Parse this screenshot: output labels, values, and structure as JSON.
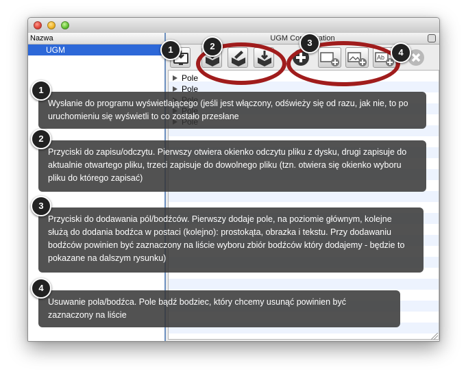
{
  "window": {
    "title": "UGM Configuration",
    "left_header": "Nazwa",
    "left_items": [
      "UGM"
    ]
  },
  "tree_rows": [
    "Pole",
    "Pole",
    "Pole",
    "Pole",
    "Pole"
  ],
  "toolbar": {
    "buttons": [
      "send-to-viewer",
      "open-file",
      "save",
      "save-as",
      "add-field",
      "add-rectangle-stimulus",
      "add-image-stimulus",
      "add-text-stimulus",
      "remove"
    ],
    "text_stimulus_label": "Ab"
  },
  "annotations": [
    {
      "number": "1",
      "text": "Wysłanie do programu wyświetlającego (jeśli jest włączony, odświeży się od razu, jak nie, to po uruchomieniu się wyświetli to co zostało przesłane"
    },
    {
      "number": "2",
      "text": "Przyciski do zapisu/odczytu. Pierwszy otwiera okienko odczytu pliku z dysku, drugi zapisuje do aktualnie otwartego pliku, trzeci zapisuje do dowolnego pliku (tzn. otwiera się okienko wyboru pliku do którego zapisać)"
    },
    {
      "number": "3",
      "text": "Przyciski do dodawania pól/bodźców. Pierwszy dodaje pole, na poziomie głównym, kolejne służą do dodania bodźca w postaci (kolejno): prostokąta, obrazka i tekstu. Przy dodawaniu bodźców powinien być zaznaczony na liście wyboru zbiór bodźców który dodajemy - będzie to pokazane na dalszym rysunku)"
    },
    {
      "number": "4",
      "text": "Usuwanie pola/bodźca. Pole bądź bodziec, który chcemy usunąć powinien być zaznaczony na liście"
    }
  ],
  "colors": {
    "highlight_ring": "#a01c1c",
    "selection": "#2d68d8",
    "callout_bg": "#343434"
  }
}
